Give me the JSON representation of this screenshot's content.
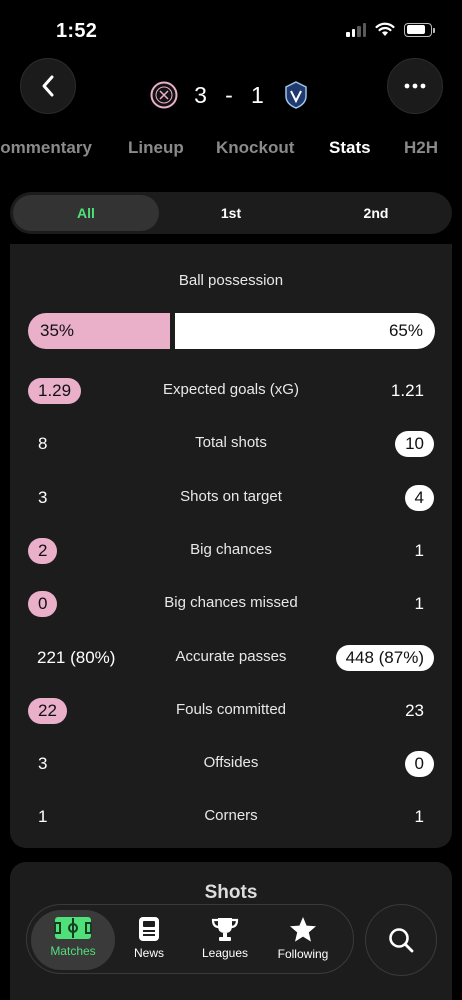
{
  "status": {
    "time": "1:52"
  },
  "header": {
    "home_score": "3",
    "separator": "-",
    "away_score": "1"
  },
  "tabs": [
    {
      "label": "Commentary"
    },
    {
      "label": "Lineup"
    },
    {
      "label": "Knockout"
    },
    {
      "label": "Stats",
      "active": true
    },
    {
      "label": "H2H"
    }
  ],
  "periods": [
    {
      "label": "All",
      "active": true
    },
    {
      "label": "1st"
    },
    {
      "label": "2nd"
    }
  ],
  "possession": {
    "title": "Ball possession",
    "home": "35%",
    "away": "65%",
    "home_fraction": 0.35
  },
  "stats": [
    {
      "label": "Expected goals (xG)",
      "home": "1.29",
      "away": "1.21",
      "highlight": "home"
    },
    {
      "label": "Total shots",
      "home": "8",
      "away": "10",
      "highlight": "away"
    },
    {
      "label": "Shots on target",
      "home": "3",
      "away": "4",
      "highlight": "away"
    },
    {
      "label": "Big chances",
      "home": "2",
      "away": "1",
      "highlight": "home"
    },
    {
      "label": "Big chances missed",
      "home": "0",
      "away": "1",
      "highlight": "home"
    },
    {
      "label": "Accurate passes",
      "home": "221 (80%)",
      "away": "448 (87%)",
      "highlight": "away"
    },
    {
      "label": "Fouls committed",
      "home": "22",
      "away": "23",
      "highlight": "home"
    },
    {
      "label": "Offsides",
      "home": "3",
      "away": "0",
      "highlight": "away"
    },
    {
      "label": "Corners",
      "home": "1",
      "away": "1",
      "highlight": "none"
    }
  ],
  "shots": {
    "title": "Shots"
  },
  "nav": [
    {
      "label": "Matches",
      "icon": "pitch-icon",
      "active": true
    },
    {
      "label": "News",
      "icon": "news-icon"
    },
    {
      "label": "Leagues",
      "icon": "trophy-icon"
    },
    {
      "label": "Following",
      "icon": "star-icon"
    }
  ],
  "colors": {
    "home": "#eab0c9",
    "away": "#ffffff",
    "accent": "#4fe07a",
    "background": "#000000",
    "card": "#1c1c1c"
  }
}
